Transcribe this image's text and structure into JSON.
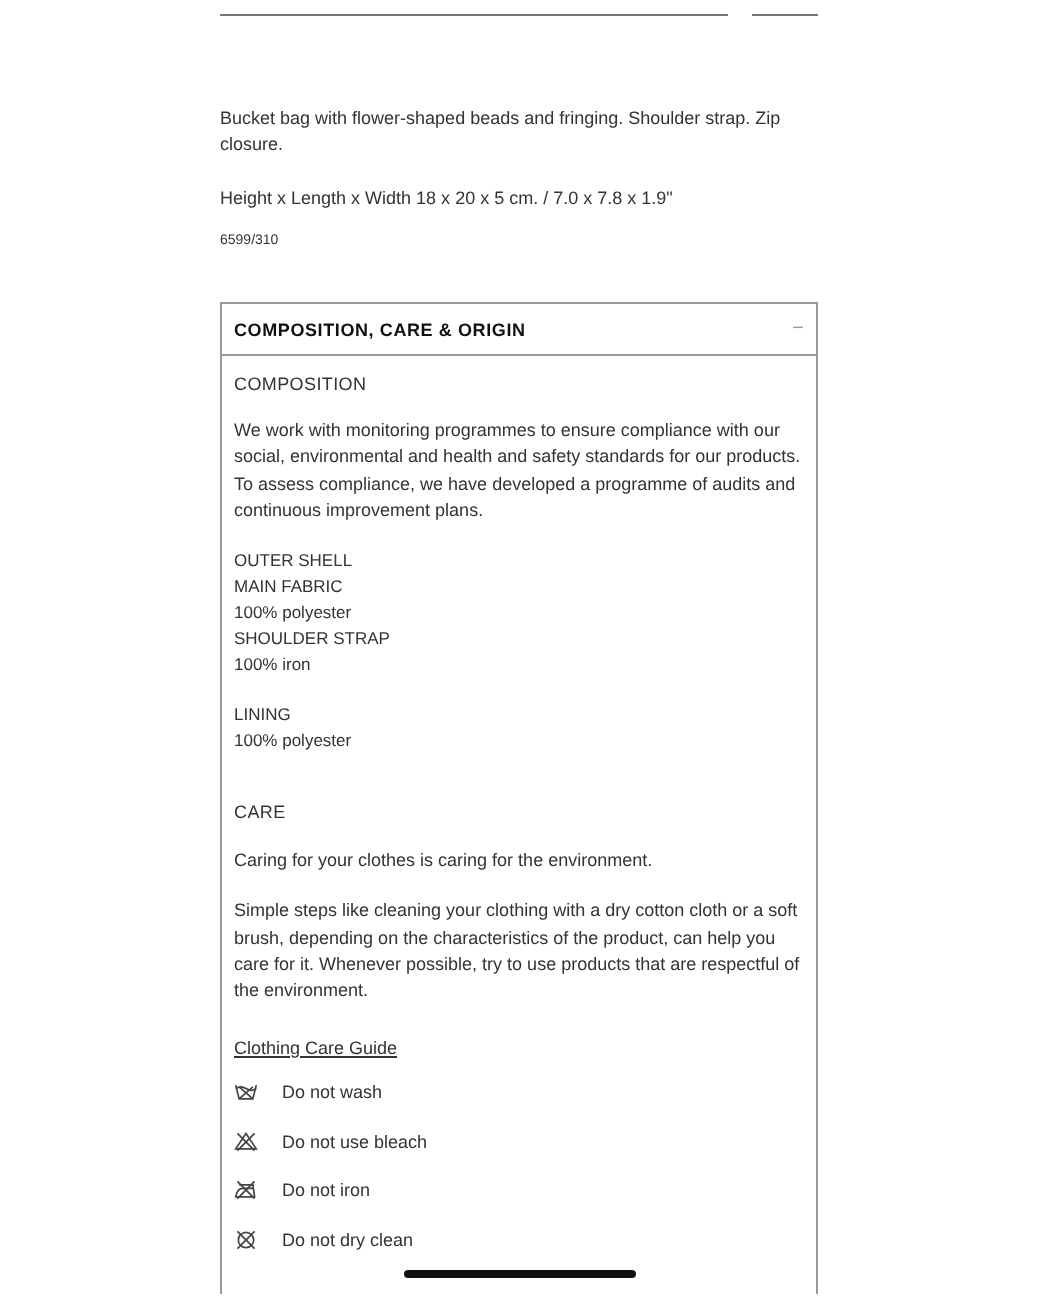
{
  "description": [
    "Bucket bag with flower-shaped beads and fringing. Shoulder strap. Zip closure.",
    "Height x Length x Width 18 x 20 x 5 cm. / 7.0 x 7.8 x 1.9\""
  ],
  "reference": "6599/310",
  "panel": {
    "title": "COMPOSITION, CARE & ORIGIN",
    "toggle": "−",
    "composition": {
      "heading": "COMPOSITION",
      "text": "We work with monitoring programmes to ensure compliance with our social, environmental and health and safety standards for our products. To assess compliance, we have developed a programme of audits and continuous improvement plans.",
      "groups": [
        [
          "OUTER SHELL",
          "MAIN FABRIC",
          "100% polyester",
          "SHOULDER STRAP",
          "100% iron"
        ],
        [
          "LINING",
          "100% polyester"
        ]
      ]
    },
    "care": {
      "heading": "CARE",
      "paragraphs": [
        "Caring for your clothes is caring for the environment.",
        "Simple steps like cleaning your clothing with a dry cotton cloth or a soft brush, depending on the characteristics of the product, can help you care for it. Whenever possible, try to use products that are respectful of the environment."
      ],
      "guide_link": "Clothing Care Guide",
      "instructions": [
        {
          "kind": "wash",
          "label": "Do not wash"
        },
        {
          "kind": "bleach",
          "label": "Do not use bleach"
        },
        {
          "kind": "iron",
          "label": "Do not iron"
        },
        {
          "kind": "dry-clean",
          "label": "Do not dry clean"
        }
      ]
    }
  }
}
